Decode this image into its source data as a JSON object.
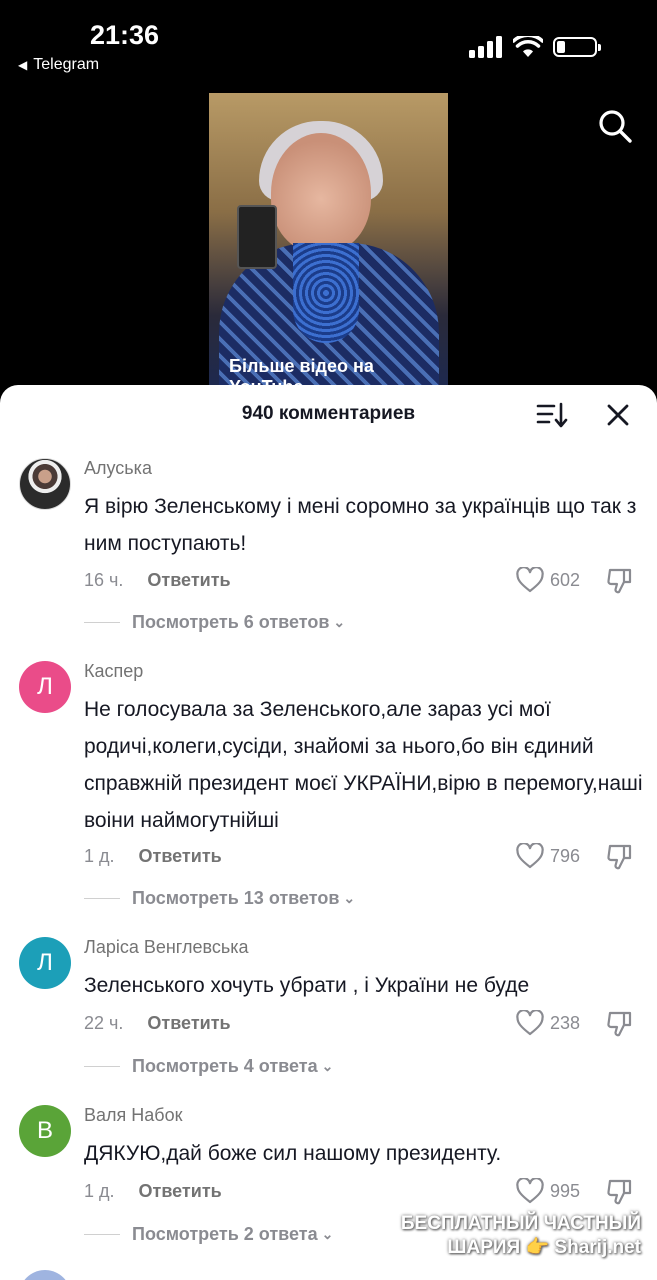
{
  "status_bar": {
    "time": "21:36",
    "back_app": "Telegram"
  },
  "video": {
    "caption": "Більше відео на YouTube"
  },
  "panel": {
    "title": "940 комментариев"
  },
  "comments": [
    {
      "username": "Алуська",
      "avatar": "photo",
      "text": "Я вірю Зеленському і мені соромно за українців що так з ним поступають!",
      "time": "16 ч.",
      "reply_label": "Ответить",
      "likes": "602",
      "view_replies": "Посмотреть 6 ответов"
    },
    {
      "username": "Каспер",
      "avatar": "Л",
      "avatar_color": "#ea4c89",
      "text": "Не голосувала за Зеленського,але зараз усі мої родичі,колеги,сусіди, знайомі за нього,бо він єдиний справжній президент моєї УКРАЇНИ,вірю в перемогу,наші воіни наймогутнійші",
      "time": "1 д.",
      "reply_label": "Ответить",
      "likes": "796",
      "view_replies": "Посмотреть 13 ответов"
    },
    {
      "username": "Ларіса Венглевська",
      "avatar": "Л",
      "avatar_color": "#1c9fb8",
      "text": "Зеленського хочуть убрати , і України не буде",
      "time": "22 ч.",
      "reply_label": "Ответить",
      "likes": "238",
      "view_replies": "Посмотреть 4 ответа"
    },
    {
      "username": "Валя Набок",
      "avatar": "В",
      "avatar_color": "#5aa438",
      "text": "ДЯКУЮ,дай боже сил нашому президенту.",
      "time": "1 д.",
      "reply_label": "Ответить",
      "likes": "995",
      "view_replies": "Посмотреть 2 ответа"
    }
  ],
  "watermark": {
    "line1": "БЕСПЛАТНЫЙ ЧАСТНЫЙ",
    "line2": "ШАРИЯ 👉 Sharij.net"
  }
}
